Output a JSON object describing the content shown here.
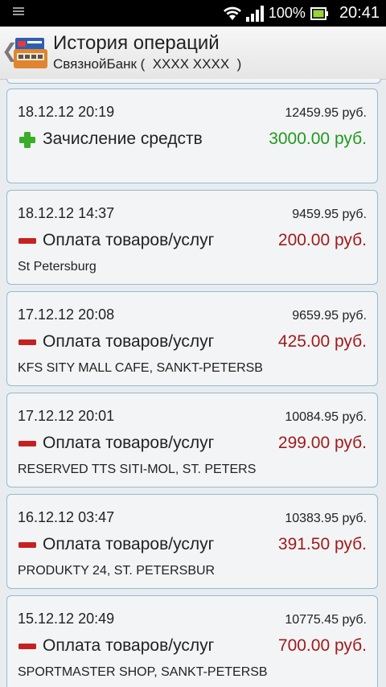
{
  "status": {
    "battery": "100%",
    "time": "20:41"
  },
  "header": {
    "title": "История операций",
    "subtitle": "СвязнойБанк (  XXXX XXXX  )"
  },
  "operations": [
    {
      "date": "18.12.12 20:19",
      "balance": "12459.95 руб.",
      "type": "Зачисление средств",
      "amount": "3000.00 руб.",
      "place": "",
      "kind": "credit"
    },
    {
      "date": "18.12.12 14:37",
      "balance": "9459.95 руб.",
      "type": "Оплата товаров/услуг",
      "amount": "200.00 руб.",
      "place": "St Petersburg",
      "kind": "debit"
    },
    {
      "date": "17.12.12 20:08",
      "balance": "9659.95 руб.",
      "type": "Оплата товаров/услуг",
      "amount": "425.00 руб.",
      "place": "KFS SITY MALL  CAFE, SANKT-PETERSB",
      "kind": "debit"
    },
    {
      "date": "17.12.12 20:01",
      "balance": "10084.95 руб.",
      "type": "Оплата товаров/услуг",
      "amount": "299.00 руб.",
      "place": "RESERVED TTS SITI-MOL, ST. PETERS",
      "kind": "debit"
    },
    {
      "date": "16.12.12 03:47",
      "balance": "10383.95 руб.",
      "type": "Оплата товаров/услуг",
      "amount": "391.50 руб.",
      "place": "PRODUKTY 24, ST. PETERSBUR",
      "kind": "debit"
    },
    {
      "date": "15.12.12 20:49",
      "balance": "10775.45 руб.",
      "type": "Оплата товаров/услуг",
      "amount": "700.00 руб.",
      "place": "SPORTMASTER  SHOP, SANKT-PETERSB",
      "kind": "debit"
    }
  ],
  "colors": {
    "credit": "#1e9a1e",
    "debit": "#9e1a1a"
  }
}
